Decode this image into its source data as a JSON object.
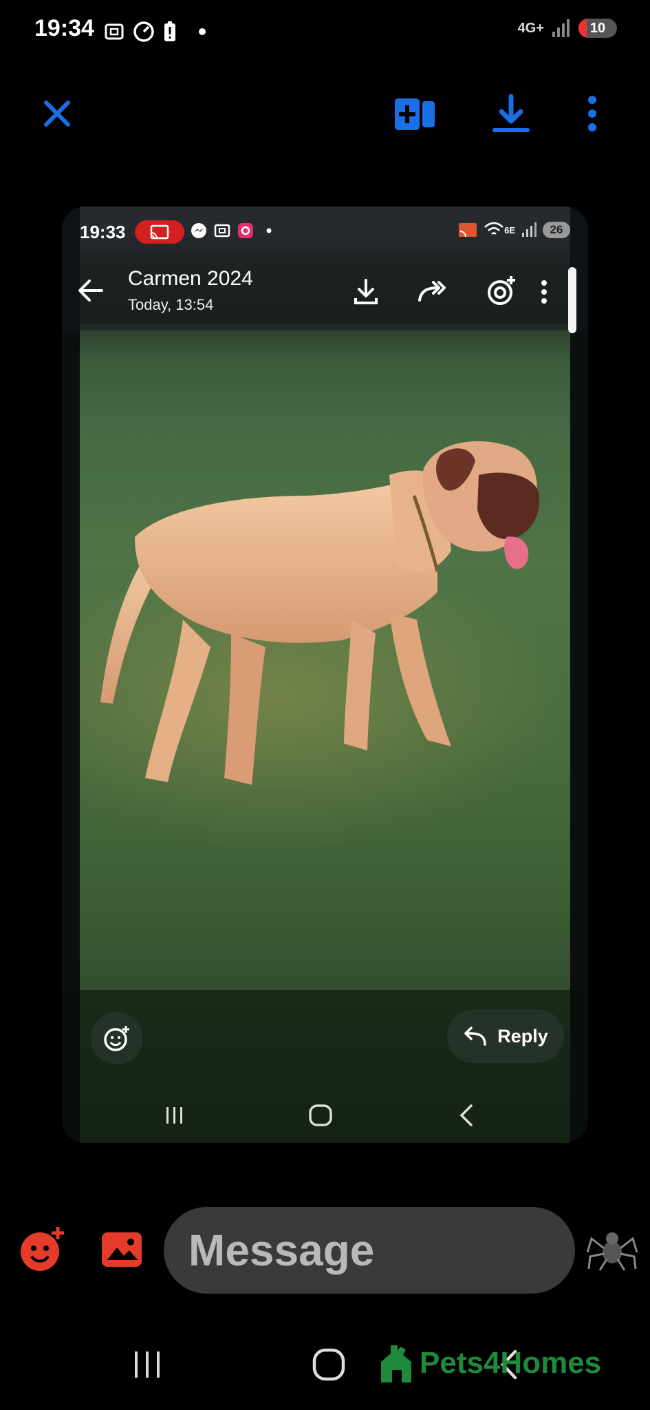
{
  "status_bar": {
    "time": "19:34",
    "network": "4G+",
    "battery": "10"
  },
  "toolbar": {
    "icons": [
      "close-icon",
      "share-to-device-icon",
      "download-icon",
      "more-vert-icon"
    ],
    "accent_color": "#1a6fe6"
  },
  "screenshot": {
    "status_time": "19:33",
    "network": "6E",
    "battery": "26",
    "chat_title": "Carmen 2024",
    "chat_subtitle": "Today, 13:54",
    "reply_label": "Reply"
  },
  "composer": {
    "placeholder": "Message",
    "accent_color": "#e53b2b"
  },
  "watermark": {
    "text": "Pets4Homes",
    "color": "#1f8a3a"
  }
}
